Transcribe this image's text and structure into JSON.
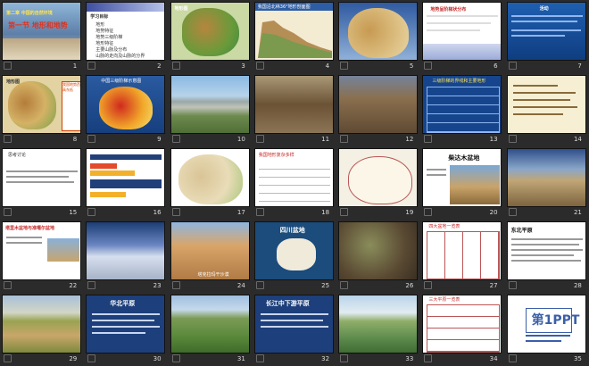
{
  "title": "Slide sorter",
  "slides": [
    {
      "number": "1",
      "title": "第一节 地形和地势",
      "subtitle": "第二章 中国的自然环境",
      "bg": "#7fa6c9"
    },
    {
      "number": "2",
      "title": "学习目标",
      "lines": [
        "地形",
        "地势特征",
        "地势三级阶梯",
        "地形特征",
        "主要山脉及分布",
        "山脉的走向及山脉的分界"
      ],
      "bg": "#ffffff"
    },
    {
      "number": "3",
      "title": "地形图",
      "bg": "#3a7a3a"
    },
    {
      "number": "4",
      "title": "我国沿北纬36°地形剖面图",
      "bg": "#d9d0b0"
    },
    {
      "number": "5",
      "title": "",
      "bg": "#b98d4f"
    },
    {
      "number": "6",
      "title": "地势呈阶梯状分布",
      "bg": "#ffffff"
    },
    {
      "number": "7",
      "title": "活动",
      "bg": "#1d5ba6"
    },
    {
      "number": "8",
      "title": "地形图",
      "side": "我国地势西高东低",
      "bg": "#d3b46c"
    },
    {
      "number": "9",
      "title": "中国三级阶梯示意图",
      "bg": "#a43a2a"
    },
    {
      "number": "10",
      "title": "",
      "bg": "#5c8e6a"
    },
    {
      "number": "11",
      "title": "",
      "bg": "#7a6240"
    },
    {
      "number": "12",
      "title": "",
      "bg": "#6b5540"
    },
    {
      "number": "13",
      "title": "三级阶梯的界线和主要地形",
      "bg": "#16458e"
    },
    {
      "number": "14",
      "title": "",
      "bg": "#f6efd3"
    },
    {
      "number": "15",
      "title": "思考讨论",
      "bg": "#ffffff"
    },
    {
      "number": "16",
      "title": "",
      "bg": "#ffffff"
    },
    {
      "number": "17",
      "title": "",
      "bg": "#ffffff"
    },
    {
      "number": "18",
      "title": "我国地形复杂多样",
      "bg": "#ffffff"
    },
    {
      "number": "19",
      "title": "",
      "bg": "#ffffff"
    },
    {
      "number": "20",
      "title": "柴达木盆地",
      "bg": "#ffffff"
    },
    {
      "number": "21",
      "title": "",
      "bg": "#8b7350"
    },
    {
      "number": "22",
      "title": "塔里木盆地与准噶尔盆地",
      "bg": "#ffffff"
    },
    {
      "number": "23",
      "title": "",
      "bg": "#1c3d75"
    },
    {
      "number": "24",
      "title": "塔克拉玛干沙漠",
      "bg": "#b07b45"
    },
    {
      "number": "25",
      "title": "四川盆地",
      "bg": "#1b4c7c"
    },
    {
      "number": "26",
      "title": "",
      "bg": "#6f5a3f"
    },
    {
      "number": "27",
      "title": "四大盆地一览表",
      "bg": "#ffffff"
    },
    {
      "number": "28",
      "title": "东北平原",
      "bg": "#ffffff"
    },
    {
      "number": "29",
      "title": "",
      "bg": "#7e8a3d"
    },
    {
      "number": "30",
      "title": "华北平原",
      "bg": "#1d3f7b"
    },
    {
      "number": "31",
      "title": "",
      "bg": "#5c8a3c"
    },
    {
      "number": "32",
      "title": "长江中下游平原",
      "bg": "#1d3f7b"
    },
    {
      "number": "33",
      "title": "",
      "bg": "#5d8b4d"
    },
    {
      "number": "34",
      "title": "三大平原一览表",
      "bg": "#ffffff"
    },
    {
      "number": "35",
      "title": "第1PPT",
      "bg": "#ffffff"
    }
  ]
}
